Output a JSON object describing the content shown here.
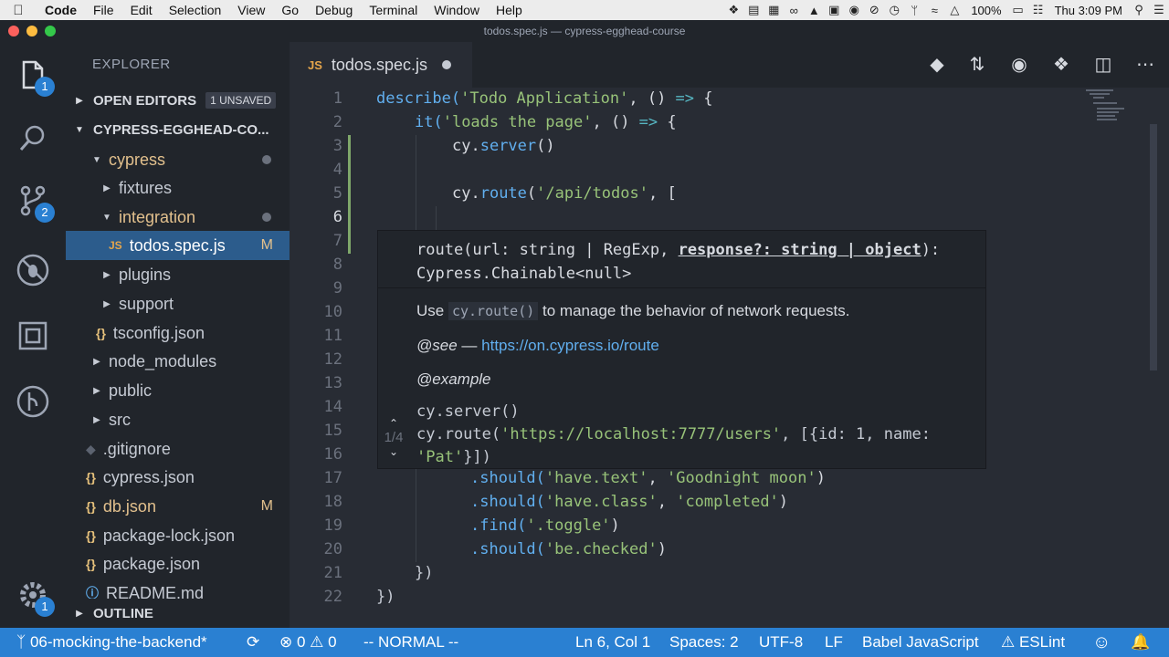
{
  "menubar": {
    "app": "Code",
    "items": [
      "File",
      "Edit",
      "Selection",
      "View",
      "Go",
      "Debug",
      "Terminal",
      "Window",
      "Help"
    ],
    "battery": "100%",
    "clock": "Thu 3:09 PM"
  },
  "window": {
    "title": "todos.spec.js — cypress-egghead-course"
  },
  "activity": {
    "explorer_badge": "1",
    "scm_badge": "2",
    "settings_badge": "1"
  },
  "sidebar": {
    "title": "EXPLORER",
    "open_editors": "OPEN EDITORS",
    "unsaved": "1 UNSAVED",
    "project": "CYPRESS-EGGHEAD-CO...",
    "outline": "OUTLINE",
    "tree": [
      {
        "label": "cypress",
        "type": "folder-open"
      },
      {
        "label": "fixtures",
        "type": "folder"
      },
      {
        "label": "integration",
        "type": "folder-open"
      },
      {
        "label": "todos.spec.js",
        "type": "js",
        "status": "M"
      },
      {
        "label": "plugins",
        "type": "folder"
      },
      {
        "label": "support",
        "type": "folder"
      },
      {
        "label": "tsconfig.json",
        "type": "json"
      },
      {
        "label": "node_modules",
        "type": "folder"
      },
      {
        "label": "public",
        "type": "folder"
      },
      {
        "label": "src",
        "type": "folder"
      },
      {
        "label": ".gitignore",
        "type": "git"
      },
      {
        "label": "cypress.json",
        "type": "json"
      },
      {
        "label": "db.json",
        "type": "json",
        "status": "M"
      },
      {
        "label": "package-lock.json",
        "type": "json"
      },
      {
        "label": "package.json",
        "type": "json"
      },
      {
        "label": "README.md",
        "type": "info"
      }
    ]
  },
  "tab": {
    "icon": "JS",
    "label": "todos.spec.js"
  },
  "editor": {
    "line_numbers": [
      "1",
      "2",
      "3",
      "4",
      "5",
      "6",
      "7",
      "8",
      "9",
      "10",
      "11",
      "12",
      "13",
      "14",
      "15",
      "16",
      "17",
      "18",
      "19",
      "20",
      "21",
      "22"
    ],
    "lines": {
      "l1": [
        "describe(",
        "'Todo Application'",
        ", () ",
        "=>",
        " {"
      ],
      "l2": [
        "it(",
        "'loads the page'",
        ", () ",
        "=>",
        " {"
      ],
      "l3": [
        "cy.",
        "server",
        "()"
      ],
      "l5": [
        "cy.",
        "route",
        "(",
        "'/api/todos'",
        ", ["
      ],
      "l17": [
        ".should(",
        "'have.text'",
        ", ",
        "'Goodnight moon'",
        ")"
      ],
      "l18": [
        ".should(",
        "'have.class'",
        ", ",
        "'completed'",
        ")"
      ],
      "l19": [
        ".find(",
        "'.toggle'",
        ")"
      ],
      "l20": [
        ".should(",
        "'be.checked'",
        ")"
      ],
      "l21": "})",
      "l22": "})"
    }
  },
  "hover": {
    "sig_pre": "route(url: string | RegExp, ",
    "sig_em": "response?: string | object",
    "sig_post": "): Cypress.Chainable<null>",
    "doc_use": "Use",
    "doc_code": "cy.route()",
    "doc_rest": "to manage the behavior of network requests.",
    "see_label": "@see",
    "see_dash": "—",
    "see_link": "https://on.cypress.io/route",
    "example_label": "@example",
    "example_l1": "cy.server()",
    "example_l2a": "cy.route(",
    "example_l2b": "'https://localhost:7777/users'",
    "example_l2c": ", [{id: 1, name: ",
    "example_l2d": "'Pat'",
    "example_l2e": "}])",
    "overload": "1/4"
  },
  "status": {
    "branch": "06-mocking-the-backend*",
    "errors": "0",
    "warnings": "0",
    "mode": "-- NORMAL --",
    "position": "Ln 6, Col 1",
    "spaces": "Spaces: 2",
    "encoding": "UTF-8",
    "eol": "LF",
    "language": "Babel JavaScript",
    "linter": "ESLint"
  },
  "colors": {
    "accent": "#2a80d2",
    "selection": "#2c5c8c",
    "string": "#98c379",
    "function": "#61afef"
  }
}
